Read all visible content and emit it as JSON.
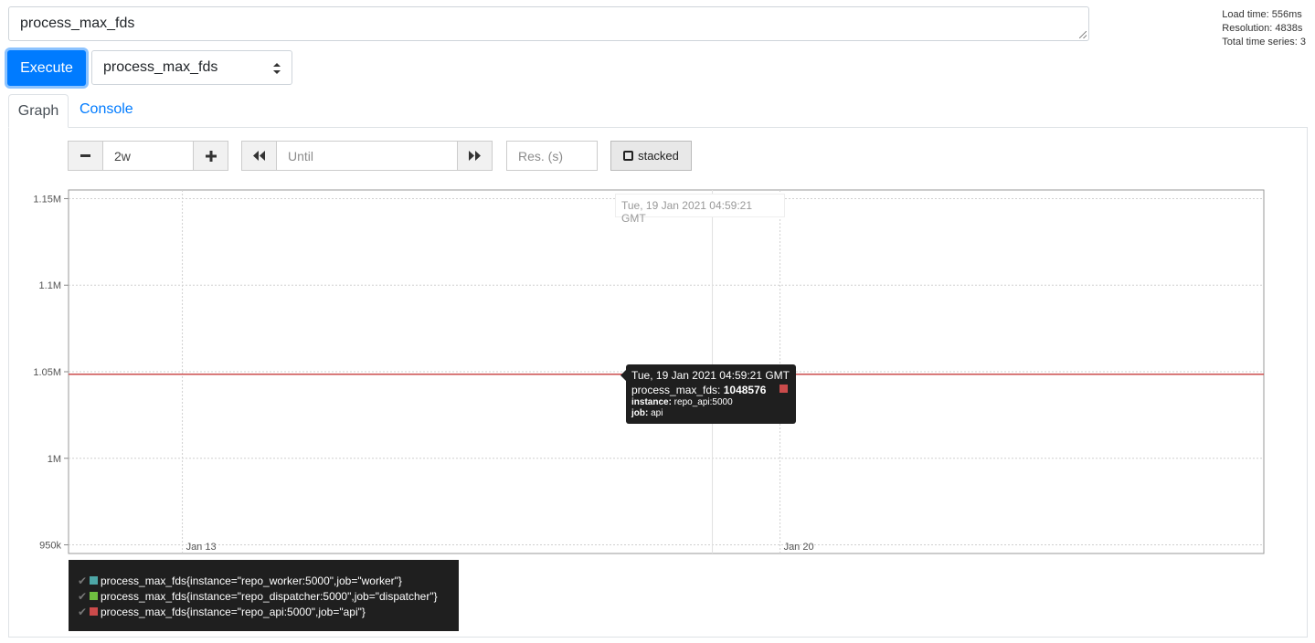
{
  "query": {
    "expression": "process_max_fds"
  },
  "stats": {
    "load_time": "Load time: 556ms",
    "resolution": "Resolution: 4838s",
    "total_series": "Total time series: 3"
  },
  "toolbar": {
    "execute_label": "Execute",
    "metric_select": "process_max_fds"
  },
  "tabs": [
    {
      "label": "Graph"
    },
    {
      "label": "Console"
    }
  ],
  "graph_controls": {
    "range_minus": "−",
    "range_value": "2w",
    "range_plus": "+",
    "until_placeholder": "Until",
    "resolution_placeholder": "Res. (s)",
    "stacked_label": "stacked"
  },
  "hover": {
    "date": "Tue, 19 Jan 2021 04:59:21 GMT",
    "tooltip_date": "Tue, 19 Jan 2021 04:59:21 GMT",
    "metric_name": "process_max_fds: ",
    "metric_value": "1048576",
    "instance_key": "instance:",
    "instance_value": " repo_api:5000",
    "job_key": "job:",
    "job_value": " api"
  },
  "colors": {
    "worker": "#4da6a6",
    "dispatcher": "#6fbf40",
    "api": "#cb4b4b",
    "line": "#4da6a6",
    "grid": "#d0d0d0"
  },
  "chart_data": {
    "type": "line",
    "x_ticks": [
      "Jan 13",
      "Jan 20"
    ],
    "y_ticks": [
      "950k",
      "1M",
      "1.05M",
      "1.1M",
      "1.15M"
    ],
    "y_tick_values": [
      950000,
      1000000,
      1050000,
      1100000,
      1150000
    ],
    "ylim": [
      945000,
      1155000
    ],
    "x_range": [
      "2021-01-11T16:00:00Z",
      "2021-01-25T16:00:00Z"
    ],
    "x_tick_values": [
      "2021-01-13T00:00:00Z",
      "2021-01-20T00:00:00Z"
    ],
    "hover_x": "2021-01-19T04:59:21Z",
    "grid": true,
    "legend_position": "bottom",
    "series": [
      {
        "name": "process_max_fds{instance=\"repo_worker:5000\",job=\"worker\"}",
        "color": "#4da6a6",
        "value": 1048576
      },
      {
        "name": "process_max_fds{instance=\"repo_dispatcher:5000\",job=\"dispatcher\"}",
        "color": "#6fbf40",
        "value": 1048576
      },
      {
        "name": "process_max_fds{instance=\"repo_api:5000\",job=\"api\"}",
        "color": "#cb4b4b",
        "value": 1048576
      }
    ]
  }
}
